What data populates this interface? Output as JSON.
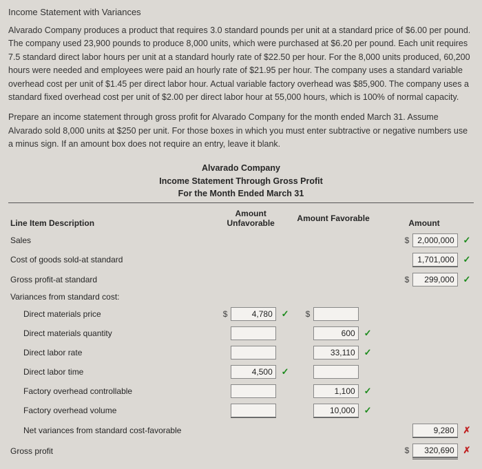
{
  "title": "Income Statement with Variances",
  "para1": "Alvarado Company produces a product that requires 3.0 standard pounds per unit at a standard price of $6.00 per pound. The company used 23,900 pounds to produce 8,000 units, which were purchased at $6.20 per pound. Each unit requires 7.5 standard direct labor hours per unit at a standard hourly rate of $22.50 per hour. For the 8,000 units produced, 60,200 hours were needed and employees were paid an hourly rate of $21.95 per hour. The company uses a standard variable overhead cost per unit of $1.45 per direct labor hour. Actual variable factory overhead was $85,900. The company uses a standard fixed overhead cost per unit of $2.00 per direct labor hour at 55,000 hours, which is 100% of normal capacity.",
  "para2": "Prepare an income statement through gross profit for Alvarado Company for the month ended March 31. Assume Alvarado sold 8,000 units at $250 per unit. For those boxes in which you must enter subtractive or negative numbers use a minus sign. If an amount box does not require an entry, leave it blank.",
  "header": {
    "l1": "Alvarado Company",
    "l2": "Income Statement Through Gross Profit",
    "l3": "For the Month Ended March 31"
  },
  "cols": {
    "desc": "Line Item Description",
    "unfav": "Amount Unfavorable",
    "fav": "Amount Favorable",
    "amount": "Amount"
  },
  "rows": {
    "sales": {
      "label": "Sales",
      "amount": "2,000,000",
      "mark": "correct"
    },
    "cogs_std": {
      "label": "Cost of goods sold-at standard",
      "amount": "1,701,000",
      "mark": "correct"
    },
    "gp_std": {
      "label": "Gross profit-at standard",
      "amount": "299,000",
      "mark": "correct"
    },
    "var_head": {
      "label": "Variances from standard cost:"
    },
    "dm_price": {
      "label": "Direct materials price",
      "unfav": "4,780",
      "unfav_mark": "correct"
    },
    "dm_qty": {
      "label": "Direct materials quantity",
      "fav": "600",
      "fav_mark": "correct"
    },
    "dl_rate": {
      "label": "Direct labor rate",
      "fav": "33,110",
      "fav_mark": "correct"
    },
    "dl_time": {
      "label": "Direct labor time",
      "unfav": "4,500",
      "unfav_mark": "correct"
    },
    "foh_ctrl": {
      "label": "Factory overhead controllable",
      "fav": "1,100",
      "fav_mark": "correct"
    },
    "foh_vol": {
      "label": "Factory overhead volume",
      "fav": "10,000",
      "fav_mark": "correct"
    },
    "net_var": {
      "label": "Net variances from standard cost-favorable",
      "amount": "9,280",
      "mark": "wrong"
    },
    "gp": {
      "label": "Gross profit",
      "amount": "320,690",
      "mark": "wrong"
    }
  }
}
